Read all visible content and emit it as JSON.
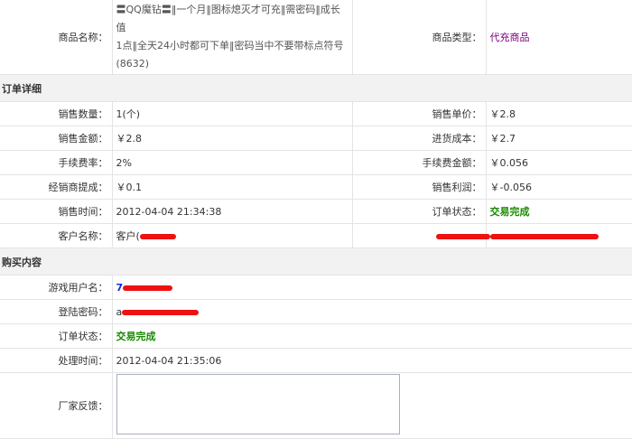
{
  "product": {
    "name_label": "商品名称：",
    "name_lines": [
      "〓QQ魔钻〓‖一个月‖图标熄灭才可充‖需密码‖成长值",
      "1点‖全天24小时都可下单‖密码当中不要带标点符号",
      "(8632)"
    ],
    "type_label": "商品类型：",
    "type_value": "代充商品"
  },
  "order_detail": {
    "section_title": "订单详细",
    "rows": [
      {
        "l1": "销售数量：",
        "v1": "1(个)",
        "l2": "销售单价：",
        "v2": "￥2.8"
      },
      {
        "l1": "销售金额：",
        "v1": "￥2.8",
        "l2": "进货成本：",
        "v2": "￥2.7"
      },
      {
        "l1": "手续费率：",
        "v1": "2%",
        "l2": "手续费金额：",
        "v2": "￥0.056"
      },
      {
        "l1": "经销商提成：",
        "v1": "￥0.1",
        "l2": "销售利润：",
        "v2": "￥-0.056"
      },
      {
        "l1": "销售时间：",
        "v1": "2012-04-04 21:34:38",
        "l2": "订单状态：",
        "v2": "交易完成"
      },
      {
        "l1": "客户名称：",
        "v1": "客户(",
        "l2": "",
        "v2": ""
      }
    ]
  },
  "purchase": {
    "section_title": "购买内容",
    "rows": [
      {
        "label": "游戏用户名：",
        "value": "7"
      },
      {
        "label": "登陆密码：",
        "value": "a"
      },
      {
        "label": "订单状态：",
        "value": "交易完成"
      },
      {
        "label": "处理时间：",
        "value": "2012-04-04 21:35:06"
      },
      {
        "label": "厂家反馈：",
        "value": ""
      }
    ]
  },
  "colors": {
    "status_green": "#1a8a00",
    "type_purple": "#800080",
    "redaction": "#ee1111"
  }
}
